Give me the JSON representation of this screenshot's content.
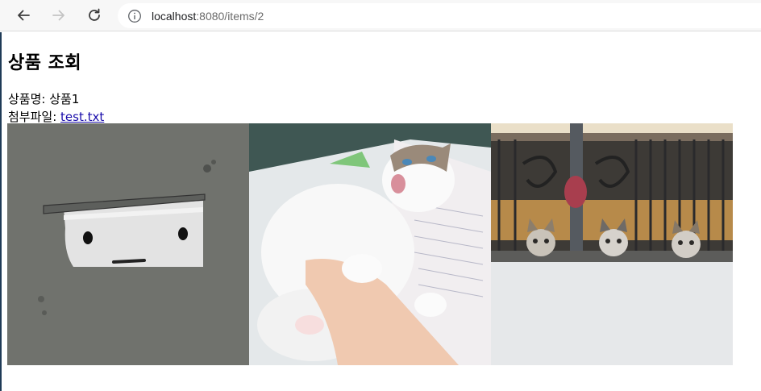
{
  "browser": {
    "url_host": "localhost",
    "url_path": ":8080/items/2"
  },
  "page": {
    "title": "상품 조회",
    "item_name_label": "상품명:",
    "item_name_value": "상품1",
    "attachment_label": "첨부파일:",
    "attachment_link": "test.txt"
  },
  "images": [
    {
      "name": "cartoon-cat-peeking-image"
    },
    {
      "name": "white-cat-held-image"
    },
    {
      "name": "cats-on-balcony-image"
    }
  ]
}
